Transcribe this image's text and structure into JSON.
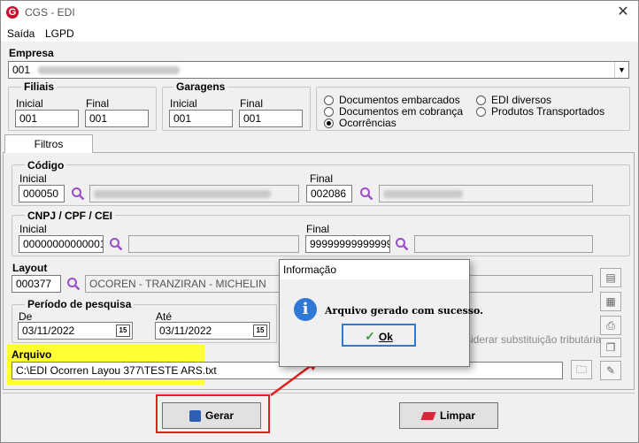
{
  "window": {
    "title": "CGS - EDI",
    "icon": "cgs-logo-icon",
    "close_glyph": "✕"
  },
  "menu": [
    {
      "label": "Saída"
    },
    {
      "label": "LGPD"
    }
  ],
  "empresa": {
    "label": "Empresa",
    "code": "001"
  },
  "filiais": {
    "title": "Filiais",
    "inicial_label": "Inicial",
    "inicial_value": "001",
    "final_label": "Final",
    "final_value": "001"
  },
  "garagens": {
    "title": "Garagens",
    "inicial_label": "Inicial",
    "inicial_value": "001",
    "final_label": "Final",
    "final_value": "001"
  },
  "doc_options": [
    {
      "label": "Documentos embarcados",
      "selected": false
    },
    {
      "label": "Documentos em cobrança",
      "selected": false
    },
    {
      "label": "Ocorrências",
      "selected": true
    },
    {
      "label": "EDI diversos",
      "selected": false
    },
    {
      "label": "Produtos Transportados",
      "selected": false
    }
  ],
  "tabs": [
    {
      "label": "Filtros",
      "active": true
    }
  ],
  "codigo": {
    "title": "Código",
    "inicial_label": "Inicial",
    "inicial_value": "000050",
    "final_label": "Final",
    "final_value": "002086"
  },
  "cnpj": {
    "title": "CNPJ / CPF / CEI",
    "inicial_label": "Inicial",
    "inicial_value": "00000000000001",
    "final_label": "Final",
    "final_value": "99999999999999"
  },
  "layout": {
    "label": "Layout",
    "code": "000377",
    "description": "OCOREN - TRANZIRAN - MICHELIN"
  },
  "periodo": {
    "title": "Período de pesquisa",
    "de_label": "De",
    "de_value": "03/11/2022",
    "ate_label": "Até",
    "ate_value": "03/11/2022",
    "calendar_glyph": "15"
  },
  "substituicao_label": "siderar substituição tributária",
  "arquivo": {
    "label": "Arquivo",
    "value": "C:\\EDI Ocorren Layou 377\\TESTE ARS.txt"
  },
  "buttons": {
    "gerar": "Gerar",
    "limpar": "Limpar"
  },
  "dialog": {
    "title": "Informação",
    "icon_glyph": "i",
    "message": "Arquivo gerado com sucesso.",
    "ok_label": "Ok",
    "ok_glyph": "✓"
  },
  "colors": {
    "highlight": "#ffff33",
    "annotation_red": "#e02020",
    "info_blue": "#2f78d6",
    "brand_red": "#c8102e"
  }
}
